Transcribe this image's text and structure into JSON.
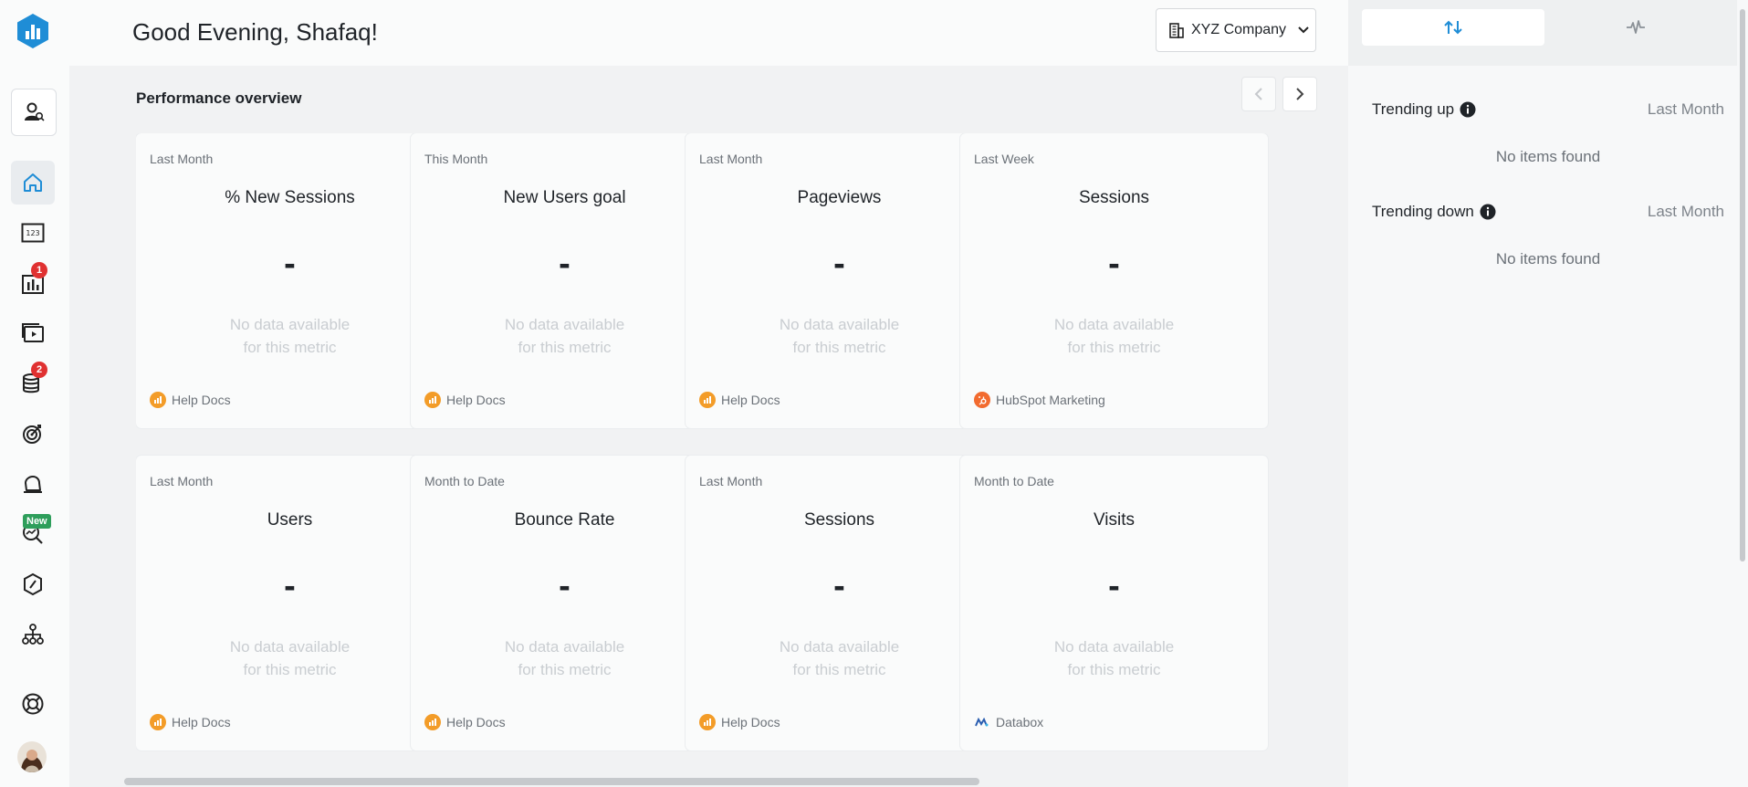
{
  "header": {
    "greeting": "Good Evening, Shafaq!",
    "company": "XYZ Company"
  },
  "sidebar": {
    "badges": {
      "metrics": "1",
      "data": "2",
      "new": "New"
    }
  },
  "main": {
    "section_title": "Performance overview",
    "cards": [
      {
        "period": "Last Month",
        "title": "% New Sessions",
        "value": "-",
        "empty_line1": "No data available",
        "empty_line2": "for this metric",
        "source": "Help Docs"
      },
      {
        "period": "This Month",
        "title": "New Users goal",
        "value": "-",
        "empty_line1": "No data available",
        "empty_line2": "for this metric",
        "source": "Help Docs"
      },
      {
        "period": "Last Month",
        "title": "Pageviews",
        "value": "-",
        "empty_line1": "No data available",
        "empty_line2": "for this metric",
        "source": "Help Docs"
      },
      {
        "period": "Last Week",
        "title": "Sessions",
        "value": "-",
        "empty_line1": "No data available",
        "empty_line2": "for this metric",
        "source": "HubSpot Marketing"
      },
      {
        "period": "Last Month",
        "title": "Users",
        "value": "-",
        "empty_line1": "No data available",
        "empty_line2": "for this metric",
        "source": "Help Docs"
      },
      {
        "period": "Month to Date",
        "title": "Bounce Rate",
        "value": "-",
        "empty_line1": "No data available",
        "empty_line2": "for this metric",
        "source": "Help Docs"
      },
      {
        "period": "Last Month",
        "title": "Sessions",
        "value": "-",
        "empty_line1": "No data available",
        "empty_line2": "for this metric",
        "source": "Help Docs"
      },
      {
        "period": "Month to Date",
        "title": "Visits",
        "value": "-",
        "empty_line1": "No data available",
        "empty_line2": "for this metric",
        "source": "Databox"
      }
    ]
  },
  "right_panel": {
    "trending_up": {
      "label": "Trending up",
      "period": "Last Month",
      "empty": "No items found"
    },
    "trending_down": {
      "label": "Trending down",
      "period": "Last Month",
      "empty": "No items found"
    }
  },
  "colors": {
    "brand_blue": "#1f8dd6",
    "badge_red": "#e03131",
    "badge_new_green": "#2e9e5b",
    "source_orange": "#f39c28",
    "hubspot_orange": "#f26b2f"
  }
}
